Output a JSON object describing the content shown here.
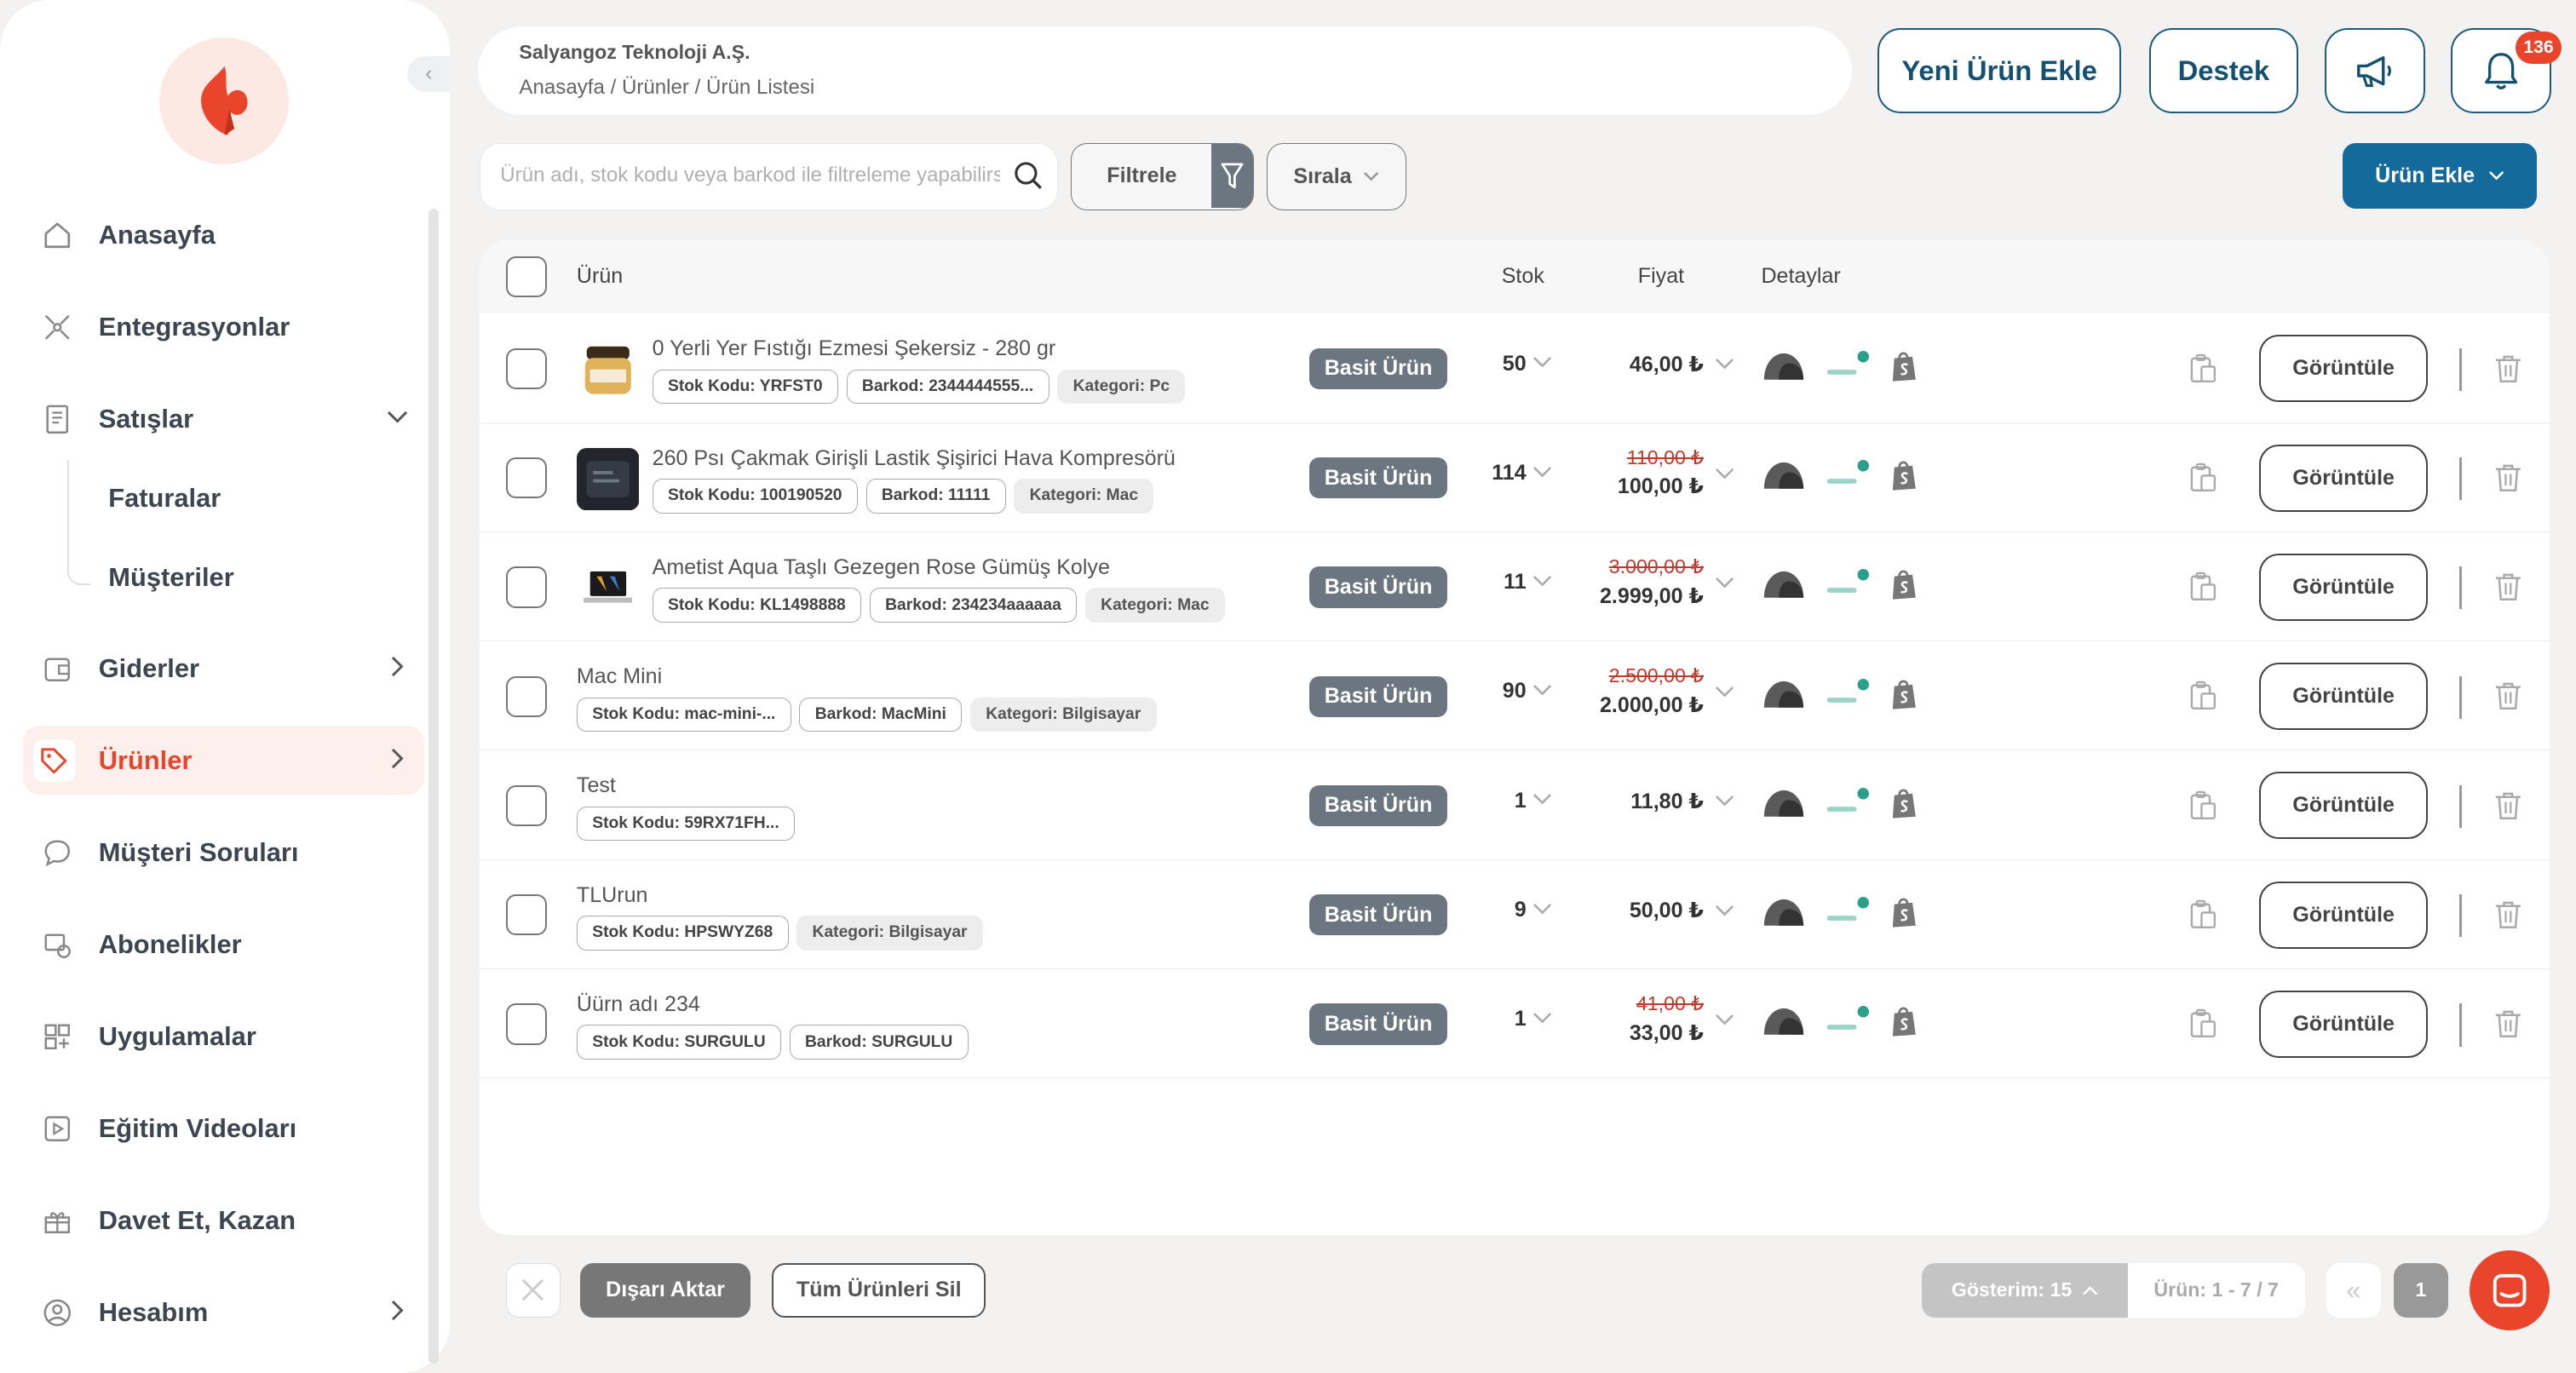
{
  "sidebar": {
    "items": [
      {
        "label": "Anasayfa",
        "icon": "home-icon"
      },
      {
        "label": "Entegrasyonlar",
        "icon": "integration-icon"
      },
      {
        "label": "Satışlar",
        "icon": "document-icon",
        "sub": [
          "Faturalar",
          "Müşteriler"
        ]
      },
      {
        "label": "Giderler",
        "icon": "wallet-icon"
      },
      {
        "label": "Ürünler",
        "icon": "tag-icon",
        "active": true
      },
      {
        "label": "Müşteri Soruları",
        "icon": "chat-bubble-icon"
      },
      {
        "label": "Abonelikler",
        "icon": "subscription-icon"
      },
      {
        "label": "Uygulamalar",
        "icon": "apps-icon"
      },
      {
        "label": "Eğitim Videoları",
        "icon": "play-icon"
      },
      {
        "label": "Davet Et, Kazan",
        "icon": "gift-icon"
      },
      {
        "label": "Hesabım",
        "icon": "user-icon"
      }
    ]
  },
  "header": {
    "company": "Salyangoz Teknoloji A.Ş.",
    "breadcrumb": "Anasayfa / Ürünler / Ürün Listesi",
    "new_product": "Yeni Ürün Ekle",
    "support": "Destek",
    "notif_count": "136"
  },
  "toolbar": {
    "search_placeholder": "Ürün adı, stok kodu veya barkod ile filtreleme yapabilirsiniz",
    "filter": "Filtrele",
    "sort": "Sırala",
    "add_product": "Ürün Ekle"
  },
  "table": {
    "headers": {
      "product": "Ürün",
      "stock": "Stok",
      "price": "Fiyat",
      "details": "Detaylar"
    },
    "view_label": "Görüntüle",
    "rows": [
      {
        "name": "0 Yerli Yer Fıstığı Ezmesi Şekersiz - 280 gr",
        "chips": [
          "Stok Kodu: YRFST0",
          "Barkod: 2344444555..."
        ],
        "cat": "Kategori: Pc",
        "type": "Basit Ürün",
        "stock": "50",
        "old_price": "",
        "price": "46,00 ₺",
        "thumb": "jar"
      },
      {
        "name": "260 Psı Çakmak Girişli Lastik Şişirici Hava Kompresörü",
        "chips": [
          "Stok Kodu: 100190520",
          "Barkod: 11111"
        ],
        "cat": "Kategori: Mac",
        "type": "Basit Ürün",
        "stock": "114",
        "old_price": "110,00 ₺",
        "price": "100,00 ₺",
        "thumb": "dark"
      },
      {
        "name": "Ametist Aqua Taşlı Gezegen Rose Gümüş Kolye",
        "chips": [
          "Stok Kodu: KL1498888",
          "Barkod: 234234aaaaaa"
        ],
        "cat": "Kategori: Mac",
        "type": "Basit Ürün",
        "stock": "11",
        "old_price": "3.000,00 ₺",
        "price": "2.999,00 ₺",
        "thumb": "laptop"
      },
      {
        "name": "Mac Mini",
        "chips": [
          "Stok Kodu: mac-mini-...",
          "Barkod: MacMini"
        ],
        "cat": "Kategori: Bilgisayar",
        "type": "Basit Ürün",
        "stock": "90",
        "old_price": "2.500,00 ₺",
        "price": "2.000,00 ₺",
        "thumb": ""
      },
      {
        "name": "Test",
        "chips": [
          "Stok Kodu: 59RX71FH..."
        ],
        "cat": "",
        "type": "Basit Ürün",
        "stock": "1",
        "old_price": "",
        "price": "11,80 ₺",
        "thumb": ""
      },
      {
        "name": "TLUrun",
        "chips": [
          "Stok Kodu: HPSWYZ68"
        ],
        "cat": "Kategori: Bilgisayar",
        "type": "Basit Ürün",
        "stock": "9",
        "old_price": "",
        "price": "50,00 ₺",
        "thumb": ""
      },
      {
        "name": "Üürn adı 234",
        "chips": [
          "Stok Kodu: SURGULU",
          "Barkod: SURGULU"
        ],
        "cat": "",
        "type": "Basit Ürün",
        "stock": "1",
        "old_price": "41,00 ₺",
        "price": "33,00 ₺",
        "thumb": ""
      }
    ]
  },
  "footer": {
    "export": "Dışarı Aktar",
    "delete_all": "Tüm Ürünleri Sil",
    "per_page": "Gösterim: 15",
    "count": "Ürün: 1 - 7 / 7",
    "page": "1"
  },
  "colors": {
    "brand": "#e8452c",
    "primary": "#146a9a",
    "dark_btn": "#6b7680"
  }
}
